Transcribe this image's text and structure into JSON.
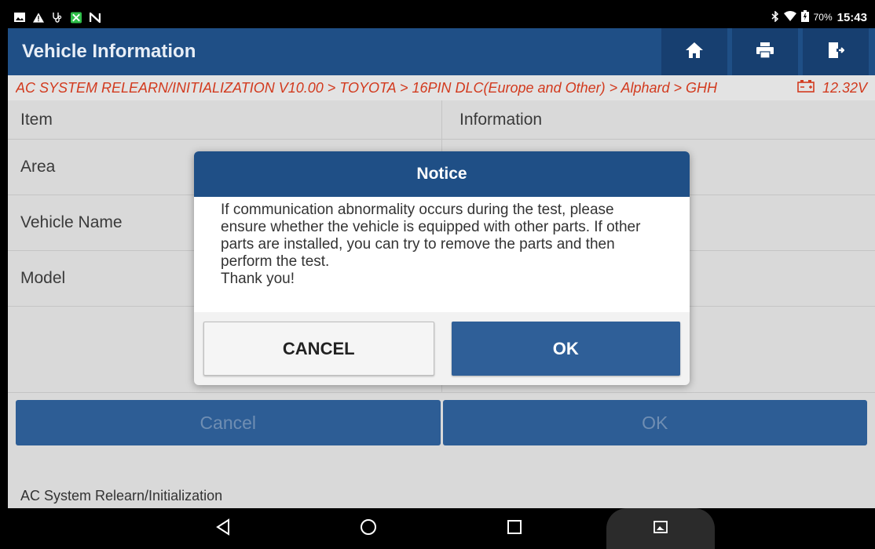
{
  "status_bar": {
    "left_icons": [
      "image-icon",
      "warning-icon",
      "stethoscope-icon",
      "app-icon",
      "n-icon"
    ],
    "battery_percent": "70%",
    "time": "15:43"
  },
  "header": {
    "title": "Vehicle Information",
    "actions": [
      "home-icon",
      "print-icon",
      "exit-icon"
    ]
  },
  "breadcrumb": {
    "path": "AC SYSTEM RELEARN/INITIALIZATION V10.00 > TOYOTA > 16PIN DLC(Europe and Other) > Alphard > GHH",
    "voltage": "12.32V"
  },
  "table": {
    "headers": [
      "Item",
      "Information"
    ],
    "rows": [
      {
        "item": "Area",
        "info": ""
      },
      {
        "item": "Vehicle Name",
        "info": ""
      },
      {
        "item": "Model",
        "info": ""
      },
      {
        "item": "",
        "info": ""
      }
    ]
  },
  "bottom_buttons": {
    "cancel": "Cancel",
    "ok": "OK"
  },
  "footer_text": "AC System Relearn/Initialization",
  "dialog": {
    "title": "Notice",
    "message": "If communication abnormality occurs during the test, please ensure whether the vehicle is equipped with other parts. If other parts are installed, you can try to remove the parts and then perform the test.",
    "thanks": "Thank you!",
    "cancel_label": "CANCEL",
    "ok_label": "OK"
  },
  "colors": {
    "header_blue": "#1f4f86",
    "breadcrumb_red": "#d23a1e",
    "button_blue": "#2f5f98"
  }
}
